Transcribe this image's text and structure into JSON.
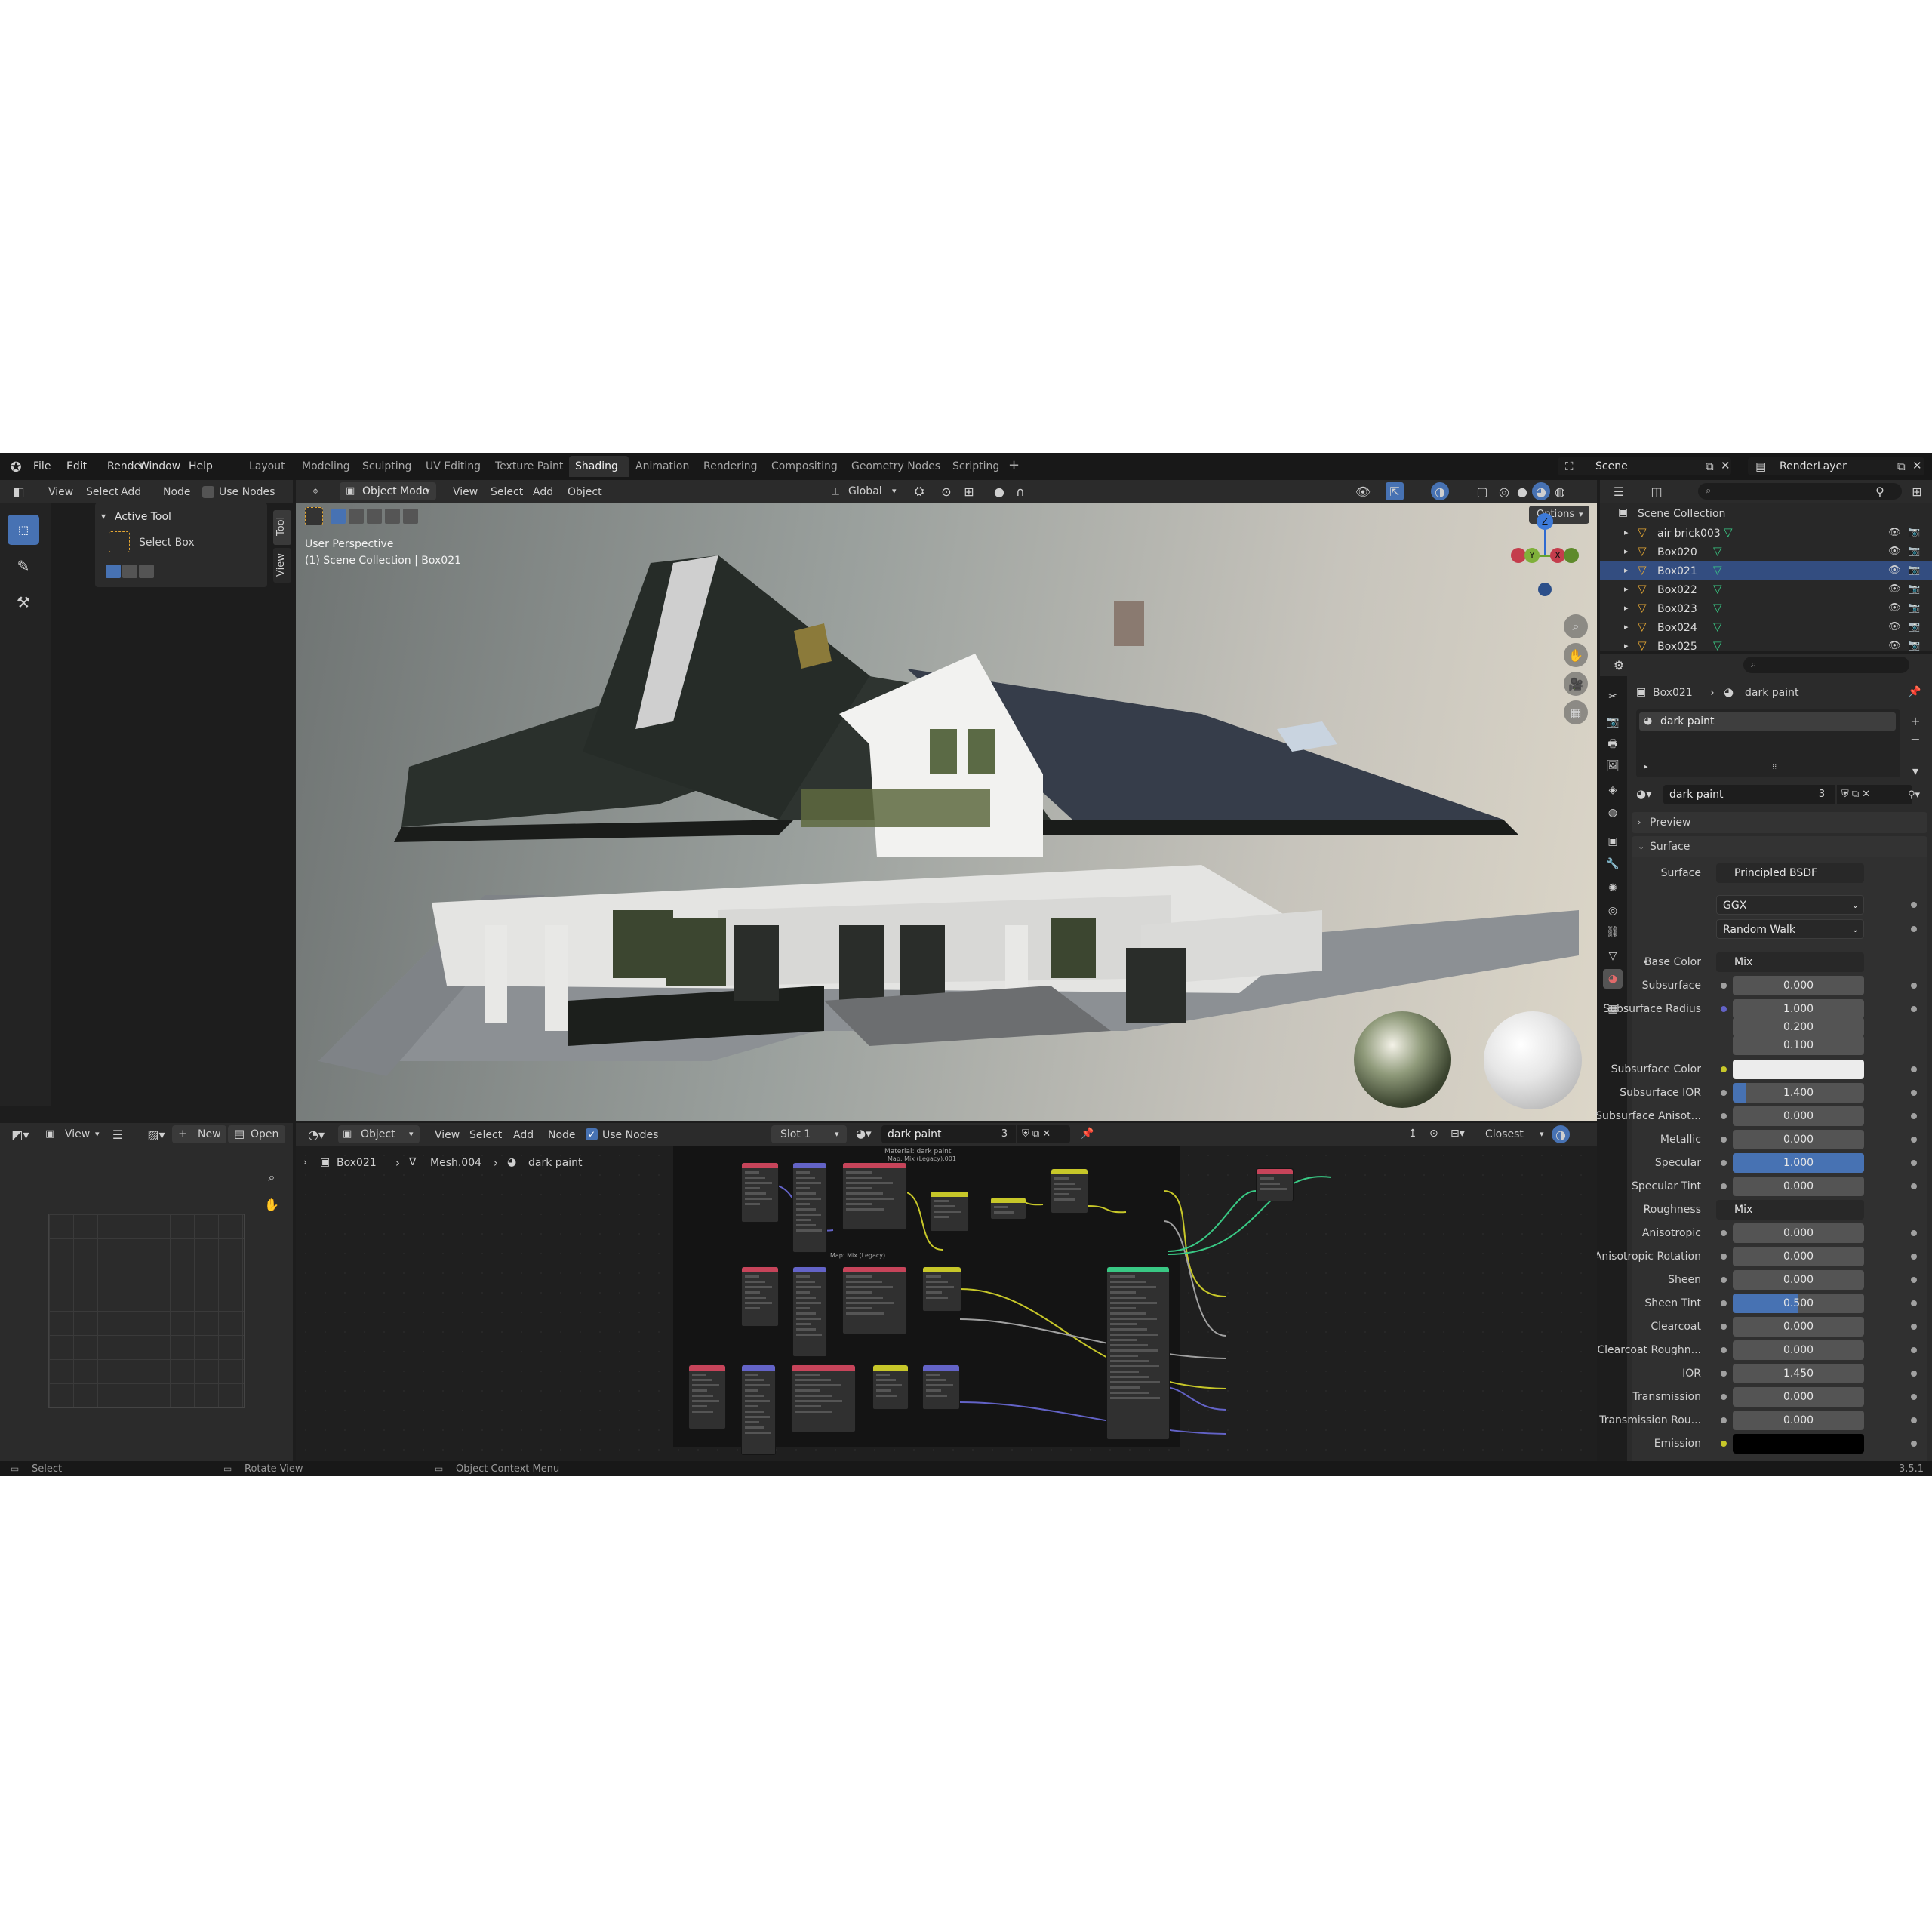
{
  "menu": {
    "items": [
      "File",
      "Edit",
      "Render",
      "Window",
      "Help"
    ]
  },
  "workspaces": [
    "Layout",
    "Modeling",
    "Sculpting",
    "UV Editing",
    "Texture Paint",
    "Shading",
    "Animation",
    "Rendering",
    "Compositing",
    "Geometry Nodes",
    "Scripting"
  ],
  "active_workspace": "Shading",
  "scene": {
    "name": "Scene",
    "render_layer": "RenderLayer"
  },
  "file_browser": {
    "menu": [
      "View",
      "Select",
      "Add",
      "Node"
    ],
    "use_nodes": "Use Nodes",
    "active_tool_title": "Active Tool",
    "select_box": "Select Box",
    "side_tabs": [
      "Tool",
      "View"
    ]
  },
  "viewport": {
    "mode": "Object Mode",
    "menu": [
      "View",
      "Select",
      "Add",
      "Object"
    ],
    "orientation": "Global",
    "options": "Options",
    "overlay_line1": "User Perspective",
    "overlay_line2": "(1) Scene Collection | Box021",
    "gizmo": {
      "z": "Z",
      "y": "Y",
      "x": "X"
    }
  },
  "outliner": {
    "root": "Scene Collection",
    "items": [
      "air brick003",
      "Box020",
      "Box021",
      "Box022",
      "Box023",
      "Box024",
      "Box025"
    ]
  },
  "properties": {
    "breadcrumb_object": "Box021",
    "breadcrumb_material": "dark paint",
    "slot_name": "dark paint",
    "material_name": "dark paint",
    "users": "3",
    "preview": "Preview",
    "surface_panel": "Surface",
    "surface_label": "Surface",
    "surface_value": "Principled BSDF",
    "distribution": "GGX",
    "subsurface_method": "Random Walk",
    "rows": [
      {
        "label": "Base Color",
        "value": "Mix",
        "type": "link",
        "arrow": true,
        "socket": "#c7c729"
      },
      {
        "label": "Subsurface",
        "value": "0.000",
        "type": "num",
        "socket": "#a1a1a1"
      },
      {
        "label": "Subsurface Radius",
        "value": "1.000",
        "type": "num",
        "socket": "#6363c7"
      },
      {
        "label": "",
        "value": "0.200",
        "type": "num",
        "socket": ""
      },
      {
        "label": "",
        "value": "0.100",
        "type": "num",
        "socket": ""
      },
      {
        "label": "Subsurface Color",
        "value": "",
        "type": "color",
        "color": "#ececec",
        "socket": "#c7c729"
      },
      {
        "label": "Subsurface IOR",
        "value": "1.400",
        "type": "num",
        "fill": 0.1,
        "socket": "#a1a1a1"
      },
      {
        "label": "Subsurface Anisot...",
        "value": "0.000",
        "type": "num",
        "socket": "#a1a1a1"
      },
      {
        "label": "Metallic",
        "value": "0.000",
        "type": "num",
        "socket": "#a1a1a1"
      },
      {
        "label": "Specular",
        "value": "1.000",
        "type": "num",
        "fill": 1.0,
        "socket": "#a1a1a1"
      },
      {
        "label": "Specular Tint",
        "value": "0.000",
        "type": "num",
        "socket": "#a1a1a1"
      },
      {
        "label": "Roughness",
        "value": "Mix",
        "type": "link",
        "arrow": true,
        "socket": "#a1a1a1"
      },
      {
        "label": "Anisotropic",
        "value": "0.000",
        "type": "num",
        "socket": "#a1a1a1"
      },
      {
        "label": "Anisotropic Rotation",
        "value": "0.000",
        "type": "num",
        "socket": "#a1a1a1"
      },
      {
        "label": "Sheen",
        "value": "0.000",
        "type": "num",
        "socket": "#a1a1a1"
      },
      {
        "label": "Sheen Tint",
        "value": "0.500",
        "type": "num",
        "fill": 0.5,
        "socket": "#a1a1a1"
      },
      {
        "label": "Clearcoat",
        "value": "0.000",
        "type": "num",
        "socket": "#a1a1a1"
      },
      {
        "label": "Clearcoat Roughn...",
        "value": "0.000",
        "type": "num",
        "socket": "#a1a1a1"
      },
      {
        "label": "IOR",
        "value": "1.450",
        "type": "num",
        "socket": "#a1a1a1"
      },
      {
        "label": "Transmission",
        "value": "0.000",
        "type": "num",
        "socket": "#a1a1a1"
      },
      {
        "label": "Transmission Rou...",
        "value": "0.000",
        "type": "num",
        "socket": "#a1a1a1"
      },
      {
        "label": "Emission",
        "value": "",
        "type": "color",
        "color": "#000000",
        "socket": "#c7c729"
      }
    ]
  },
  "image_editor": {
    "view": "View",
    "new": "New",
    "open": "Open"
  },
  "node_editor": {
    "object": "Object",
    "menu": [
      "View",
      "Select",
      "Add",
      "Node"
    ],
    "use_nodes": "Use Nodes",
    "slot": "Slot 1",
    "material": "dark paint",
    "users": "3",
    "interp": "Closest",
    "breadcrumb": [
      "Box021",
      "Mesh.004",
      "dark paint"
    ],
    "frame_title": "Material: dark paint",
    "frame_sub": "Map: Mix (Legacy).001",
    "frame_sub2": "Map: Mix (Legacy)"
  },
  "status": {
    "select": "Select",
    "rotate": "Rotate View",
    "context": "Object Context Menu",
    "version": "3.5.1"
  },
  "colors": {
    "accent": "#4772b3",
    "header": "#2b2b2b",
    "panel": "#303030",
    "bg": "#1d1d1d"
  }
}
